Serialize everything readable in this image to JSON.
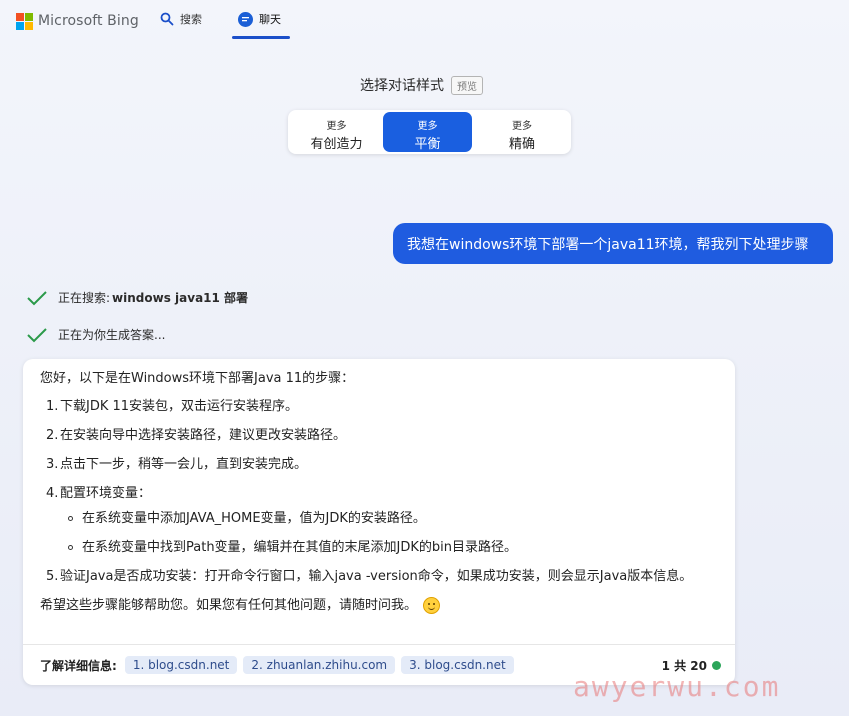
{
  "header": {
    "brand": "Microsoft Bing",
    "search_label": "搜索",
    "chat_label": "聊天",
    "brand_colors": [
      "#f25022",
      "#7fba00",
      "#00a4ef",
      "#ffb900"
    ]
  },
  "style_selector": {
    "title": "选择对话样式",
    "badge": "预览",
    "options": [
      {
        "line1": "更多",
        "line2": "有创造力",
        "active": false
      },
      {
        "line1": "更多",
        "line2": "平衡",
        "active": true
      },
      {
        "line1": "更多",
        "line2": "精确",
        "active": false
      }
    ]
  },
  "user_message": "我想在windows环境下部署一个java11环境，帮我列下处理步骤",
  "status": {
    "searching_prefix": "正在搜索:",
    "searching_query": "windows java11 部署",
    "generating": "正在为你生成答案..."
  },
  "answer": {
    "intro": "您好，以下是在Windows环境下部署Java 11的步骤：",
    "steps": [
      {
        "num": "1.",
        "text": "下载JDK 11安装包，双击运行安装程序。"
      },
      {
        "num": "2.",
        "text": "在安装向导中选择安装路径，建议更改安装路径。"
      },
      {
        "num": "3.",
        "text": "点击下一步，稍等一会儿，直到安装完成。"
      },
      {
        "num": "4.",
        "text": "配置环境变量：",
        "sub": [
          "在系统变量中添加JAVA_HOME变量，值为JDK的安装路径。",
          "在系统变量中找到Path变量，编辑并在其值的末尾添加JDK的bin目录路径。"
        ]
      },
      {
        "num": "5.",
        "text": "验证Java是否成功安装：打开命令行窗口，输入java -version命令，如果成功安装，则会显示Java版本信息。"
      }
    ],
    "outro": "希望这些步骤能够帮助您。如果您有任何其他问题，请随时问我。",
    "learn_more_label": "了解详细信息:",
    "sources": [
      "1. blog.csdn.net",
      "2. zhuanlan.zhihu.com",
      "3. blog.csdn.net"
    ],
    "count": "1 共 20"
  },
  "watermark": "awyerwu.com"
}
